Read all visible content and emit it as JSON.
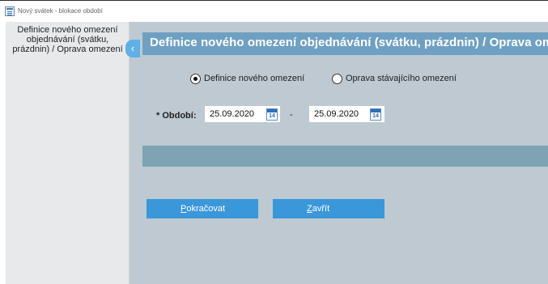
{
  "window": {
    "title": "Nový svátek - blokace období",
    "icon": "form-icon"
  },
  "sidebar": {
    "text": "Definice nového omezení objednávání (svátku, prázdnin) / Oprava omezení",
    "collapse_icon": "chevron-left-icon",
    "collapse_glyph": "‹"
  },
  "main": {
    "header": "Definice nového omezení objednávání (svátku, prázdnin) / Oprava omezení",
    "radios": [
      {
        "label": "Definice nového omezení",
        "checked": true
      },
      {
        "label": "Oprava stávajícího omezení",
        "checked": false
      }
    ],
    "period": {
      "label": "* Období:",
      "from_value": "25.09.2020",
      "separator": "-",
      "to_value": "25.09.2020",
      "calendar_icon": "calendar-icon",
      "calendar_day": "14"
    },
    "buttons": {
      "continue": {
        "accel": "P",
        "rest": "okračovat"
      },
      "close": {
        "accel": "Z",
        "rest": "avřít"
      }
    }
  },
  "colors": {
    "main_background": "#bec9d2",
    "header_band": "#6fa0c2",
    "gray_band": "#7ea3b3",
    "button": "#3a97da",
    "sidebar": "#e8e9eb",
    "collapse_tab": "#5fb0e5"
  }
}
